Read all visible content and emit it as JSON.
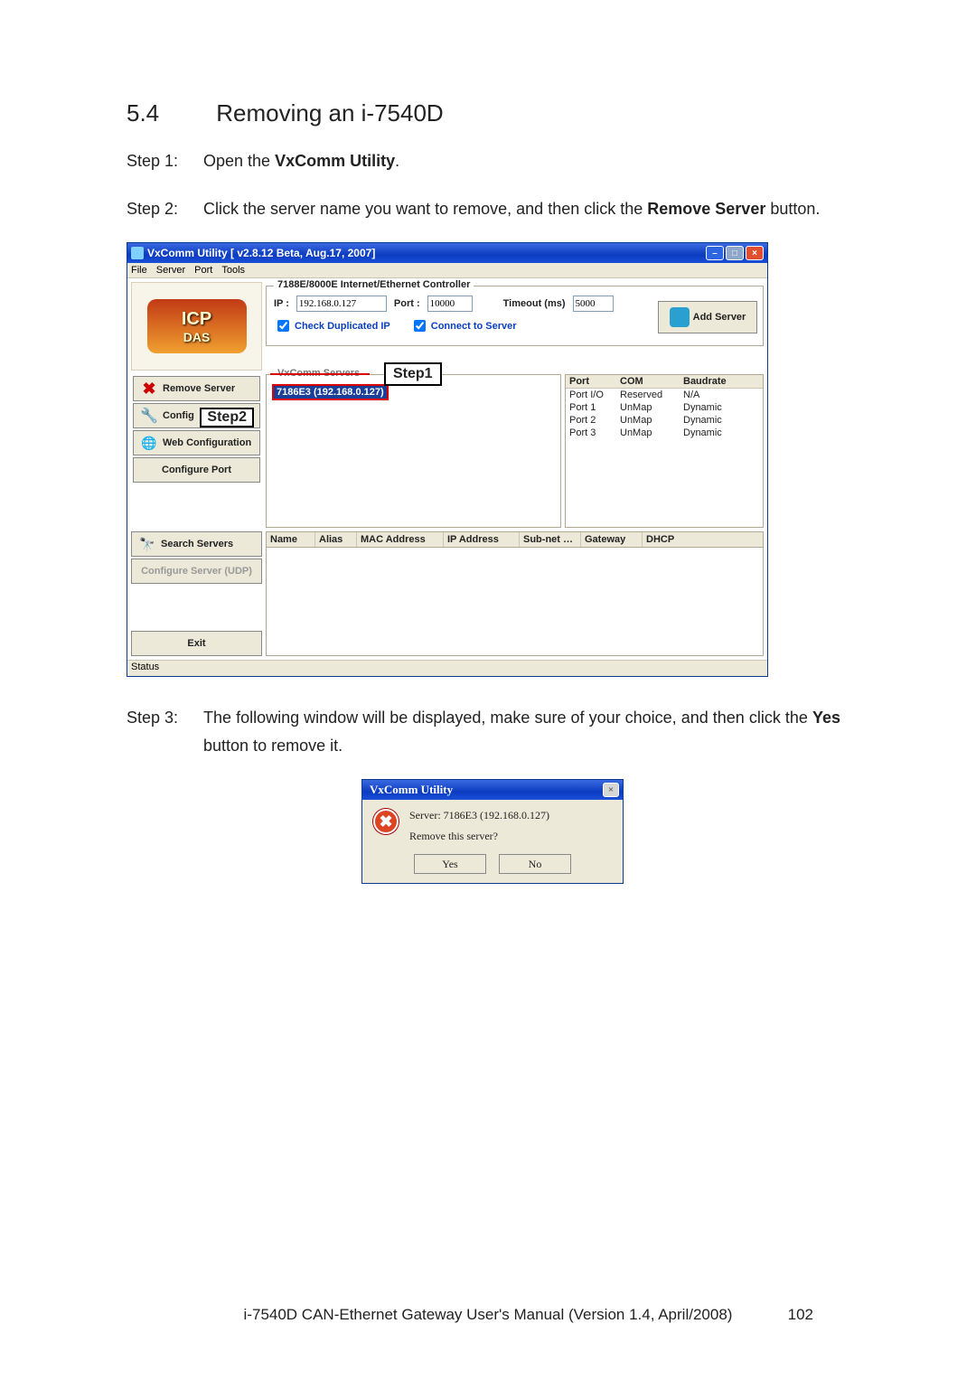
{
  "doc": {
    "section_num": "5.4",
    "section_title": "Removing an i-7540D",
    "step1_label": "Step 1:",
    "step1_a": "Open the ",
    "step1_b": "VxComm Utility",
    "step1_c": ".",
    "step2_label": "Step 2:",
    "step2_a": "Click the server name you want to remove, and then click the ",
    "step2_b": "Remove Server",
    "step2_c": " button.",
    "step3_label": "Step 3:",
    "step3_a": "The following window will be displayed, make sure of your choice, and then click the ",
    "step3_b": "Yes",
    "step3_c": " button to remove it.",
    "footer": "i-7540D CAN-Ethernet Gateway User's Manual (Version 1.4, April/2008)",
    "page_number": "102"
  },
  "win": {
    "title": "VxComm Utility [ v2.8.12 Beta, Aug.17, 2007]",
    "menu": {
      "file": "File",
      "server": "Server",
      "port": "Port",
      "tools": "Tools"
    },
    "logo_top": "ICP",
    "logo_bot": "DAS",
    "group_title": "7188E/8000E Internet/Ethernet Controller",
    "ip_label": "IP :",
    "ip_value": "192.168.0.127",
    "port_label": "Port :",
    "port_value": "10000",
    "timeout_label": "Timeout (ms)",
    "timeout_value": "5000",
    "chk_dup": "Check Duplicated IP",
    "chk_conn": "Connect to Server",
    "add_server": "Add Server",
    "vcs_legend": "VxComm Servers",
    "server_entry": "7186E3 (192.168.0.127)",
    "step1_badge": "Step1",
    "step2_badge": "Step2",
    "side": {
      "remove": "Remove Server",
      "config": "Config",
      "webcfg": "Web Configuration",
      "cfgport": "Configure Port",
      "search": "Search Servers",
      "udp": "Configure Server (UDP)",
      "exit": "Exit"
    },
    "ports": {
      "h_port": "Port",
      "h_com": "COM",
      "h_baud": "Baudrate",
      "rows": [
        {
          "port": "Port I/O",
          "com": "Reserved",
          "baud": "N/A"
        },
        {
          "port": "Port 1",
          "com": "UnMap",
          "baud": "Dynamic"
        },
        {
          "port": "Port 2",
          "com": "UnMap",
          "baud": "Dynamic"
        },
        {
          "port": "Port 3",
          "com": "UnMap",
          "baud": "Dynamic"
        }
      ]
    },
    "search": {
      "name": "Name",
      "alias": "Alias",
      "mac": "MAC Address",
      "ip": "IP Address",
      "sub": "Sub-net …",
      "gw": "Gateway",
      "dhcp": "DHCP"
    },
    "status": "Status"
  },
  "dlg": {
    "title": "VxComm Utility",
    "line1": "Server: 7186E3 (192.168.0.127)",
    "line2": "Remove this server?",
    "yes": "Yes",
    "no": "No"
  }
}
